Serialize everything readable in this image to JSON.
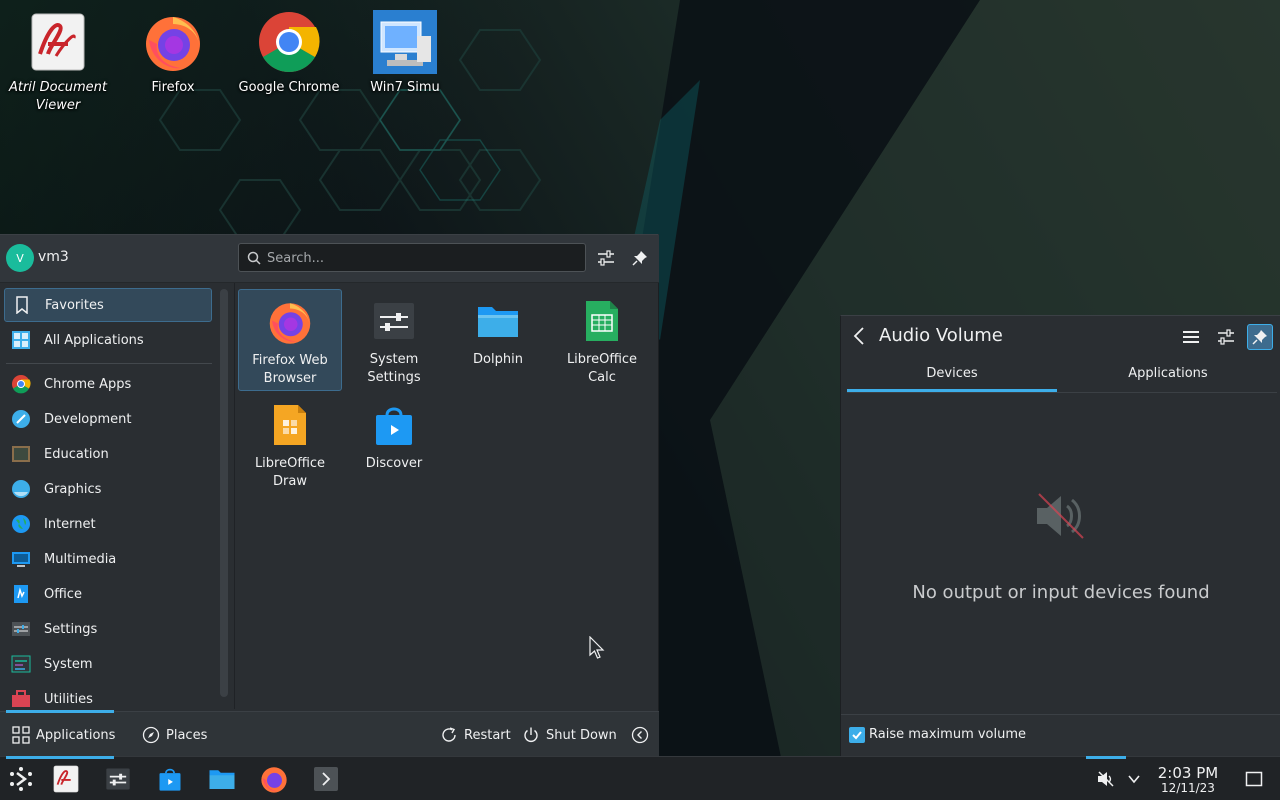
{
  "desktop": {
    "icons": [
      {
        "label": "Atril Document Viewer",
        "icon": "atril-icon"
      },
      {
        "label": "Firefox",
        "icon": "firefox-icon"
      },
      {
        "label": "Google Chrome",
        "icon": "chrome-icon"
      },
      {
        "label": "Win7 Simu",
        "icon": "win7-simu-icon"
      }
    ]
  },
  "launcher": {
    "user": {
      "initial": "V",
      "name": "vm3"
    },
    "search": {
      "placeholder": "Search..."
    },
    "categories": [
      {
        "label": "Favorites",
        "icon": "bookmark-icon",
        "active": true
      },
      {
        "label": "All Applications",
        "icon": "grid-icon"
      },
      {
        "label": "Chrome Apps",
        "icon": "chrome-icon"
      },
      {
        "label": "Development",
        "icon": "development-icon"
      },
      {
        "label": "Education",
        "icon": "education-icon"
      },
      {
        "label": "Graphics",
        "icon": "graphics-icon"
      },
      {
        "label": "Internet",
        "icon": "internet-icon"
      },
      {
        "label": "Multimedia",
        "icon": "multimedia-icon"
      },
      {
        "label": "Office",
        "icon": "office-icon"
      },
      {
        "label": "Settings",
        "icon": "settings-icon"
      },
      {
        "label": "System",
        "icon": "system-icon"
      },
      {
        "label": "Utilities",
        "icon": "utilities-icon"
      }
    ],
    "favorites": [
      {
        "label": "Firefox Web Browser",
        "icon": "firefox-icon",
        "selected": true
      },
      {
        "label": "System Settings",
        "icon": "system-settings-icon"
      },
      {
        "label": "Dolphin",
        "icon": "dolphin-folder-icon"
      },
      {
        "label": "LibreOffice Calc",
        "icon": "libreoffice-calc-icon"
      },
      {
        "label": "LibreOffice Draw",
        "icon": "libreoffice-draw-icon"
      },
      {
        "label": "Discover",
        "icon": "discover-icon"
      }
    ],
    "footer": {
      "applications": "Applications",
      "places": "Places",
      "restart": "Restart",
      "shutdown": "Shut Down"
    }
  },
  "audio": {
    "title": "Audio Volume",
    "tabs": [
      "Devices",
      "Applications"
    ],
    "active_tab": "Devices",
    "empty_message": "No output or input devices found",
    "raise_max_volume": {
      "label": "Raise maximum volume",
      "checked": true
    }
  },
  "taskbar": {
    "items": [
      "kickoff-launcher-icon",
      "atril-icon",
      "system-settings-icon",
      "discover-icon",
      "dolphin-folder-icon",
      "firefox-icon",
      "terminal-icon"
    ],
    "clock": {
      "time": "2:03 PM",
      "date": "12/11/23"
    }
  },
  "colors": {
    "accent": "#3daee9",
    "panel": "#2a2e32",
    "taskbar": "#202326"
  }
}
